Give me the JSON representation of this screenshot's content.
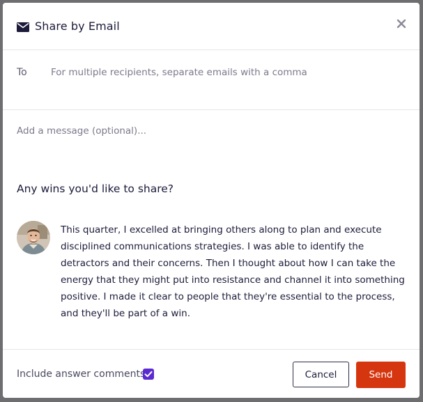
{
  "dialog": {
    "title": "Share by Email",
    "icon": "envelope-icon",
    "close_icon": "close-icon"
  },
  "to_field": {
    "label": "To",
    "placeholder": "For multiple recipients, separate emails with a comma",
    "value": ""
  },
  "message_field": {
    "placeholder": "Add a message (optional)...",
    "value": ""
  },
  "question": {
    "text": "Any wins you'd like to share?"
  },
  "answer": {
    "avatar_icon": "user-avatar",
    "text": "This quarter, I excelled at bringing others along to plan and execute disciplined communications strategies. I was able to identify the detractors and their concerns. Then I thought about how I can take the energy that they might put into resistance and channel it into something positive. I made it clear to people that they're essential to the process, and they'll be part of a win."
  },
  "footer": {
    "include_comments_label": "Include answer comments",
    "include_comments_checked": true,
    "cancel_label": "Cancel",
    "send_label": "Send"
  },
  "colors": {
    "accent": "#5b2bd1",
    "send": "#d5360f",
    "text": "#1c1b3a"
  }
}
